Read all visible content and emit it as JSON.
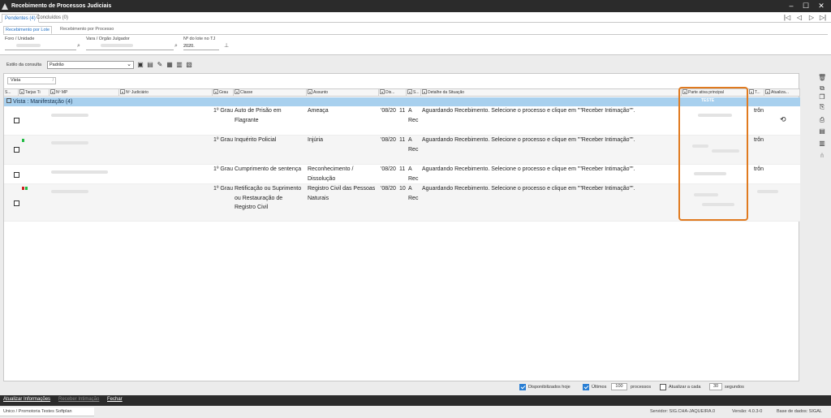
{
  "window": {
    "title": "Recebimento de Processos Judiciais"
  },
  "main_tabs": [
    {
      "label": "Pendentes (4)"
    },
    {
      "label": "Concluídos (0)"
    }
  ],
  "sub_tabs": [
    {
      "label": "Recebimento por Lote"
    },
    {
      "label": "Recebimento por Processo"
    }
  ],
  "filters": {
    "foro_label": "Foro / Unidade",
    "vara_label": "Vara / Orgão Julgador",
    "lote_label": "Nº do lote no TJ",
    "lote_value": "2020."
  },
  "query": {
    "label": "Estilo da consulta",
    "value": "Padrão"
  },
  "grid": {
    "group_by": "Vista",
    "columns": [
      "S...",
      "Tarjas Ti",
      "Nº MP",
      "Nº Judiciário",
      "Grau",
      "Classe",
      "Assunto",
      "Dis...",
      "S...",
      "Detalhe da Situação",
      "Parte ativa principal",
      "T...",
      "Atualiza..."
    ],
    "group_label": "Vista : Manifestação (4)",
    "highlight_header": "TESTE",
    "rows": [
      {
        "grau": "1º Grau",
        "classe": "Auto de Prisão em Flagrante",
        "assunto": "Ameaça",
        "dis": "'08/20",
        "num": "11",
        "s": "A Rec",
        "detalhe": "Aguardando Recebimento. Selecione o processo e clique em \"\"Receber Intimação\"\".",
        "t": "trôn",
        "updated": true,
        "tags": []
      },
      {
        "grau": "1º Grau",
        "classe": "Inquérito Policial",
        "assunto": "Injúria",
        "dis": "'08/20",
        "num": "11",
        "s": "A Rec",
        "detalhe": "Aguardando Recebimento. Selecione o processo e clique em \"\"Receber Intimação\"\".",
        "t": "trôn",
        "updated": false,
        "tags": [
          "#22bb44"
        ]
      },
      {
        "grau": "1º Grau",
        "classe": "Cumprimento de sentença",
        "assunto": "Reconhecimento / Dissolução",
        "dis": "'08/20",
        "num": "11",
        "s": "A Rec",
        "detalhe": "Aguardando Recebimento. Selecione o processo e clique em \"\"Receber Intimação\"\".",
        "t": "trôn",
        "updated": false,
        "tags": []
      },
      {
        "grau": "1º Grau",
        "classe": "Retificação ou Suprimento ou Restauração de Registro Civil",
        "assunto": "Registro Civil das Pessoas Naturais",
        "dis": "'08/20",
        "num": "10",
        "s": "A Rec",
        "detalhe": "Aguardando Recebimento. Selecione o processo e clique em \"\"Receber Intimação\"\".",
        "t": "",
        "updated": false,
        "tags": [
          "#cc2222",
          "#22bb44"
        ]
      }
    ]
  },
  "options": {
    "disponibilizados": "Disponibilizados hoje",
    "ultimos": "Últimos",
    "ultimos_value": "100",
    "processos": "processos",
    "atualizar": "Atualizar a cada",
    "atualizar_value": "30",
    "segundos": "segundos"
  },
  "actions": {
    "atualizar": "Atualizar Informações",
    "receber": "Receber Intimação",
    "fechar": "Fechar"
  },
  "status": {
    "user": "Unico / Promotoria Testes Softplan",
    "servidor": "Servidor: SIG.CHA-JAQUEIRA.0",
    "versao": "Versão: 4.0.3-0",
    "base": "Base de dados: SIGAL"
  },
  "colors": {
    "group_row": "#a8d0ee",
    "highlight_border": "#e07a1f",
    "accent": "#1f6fc5"
  }
}
